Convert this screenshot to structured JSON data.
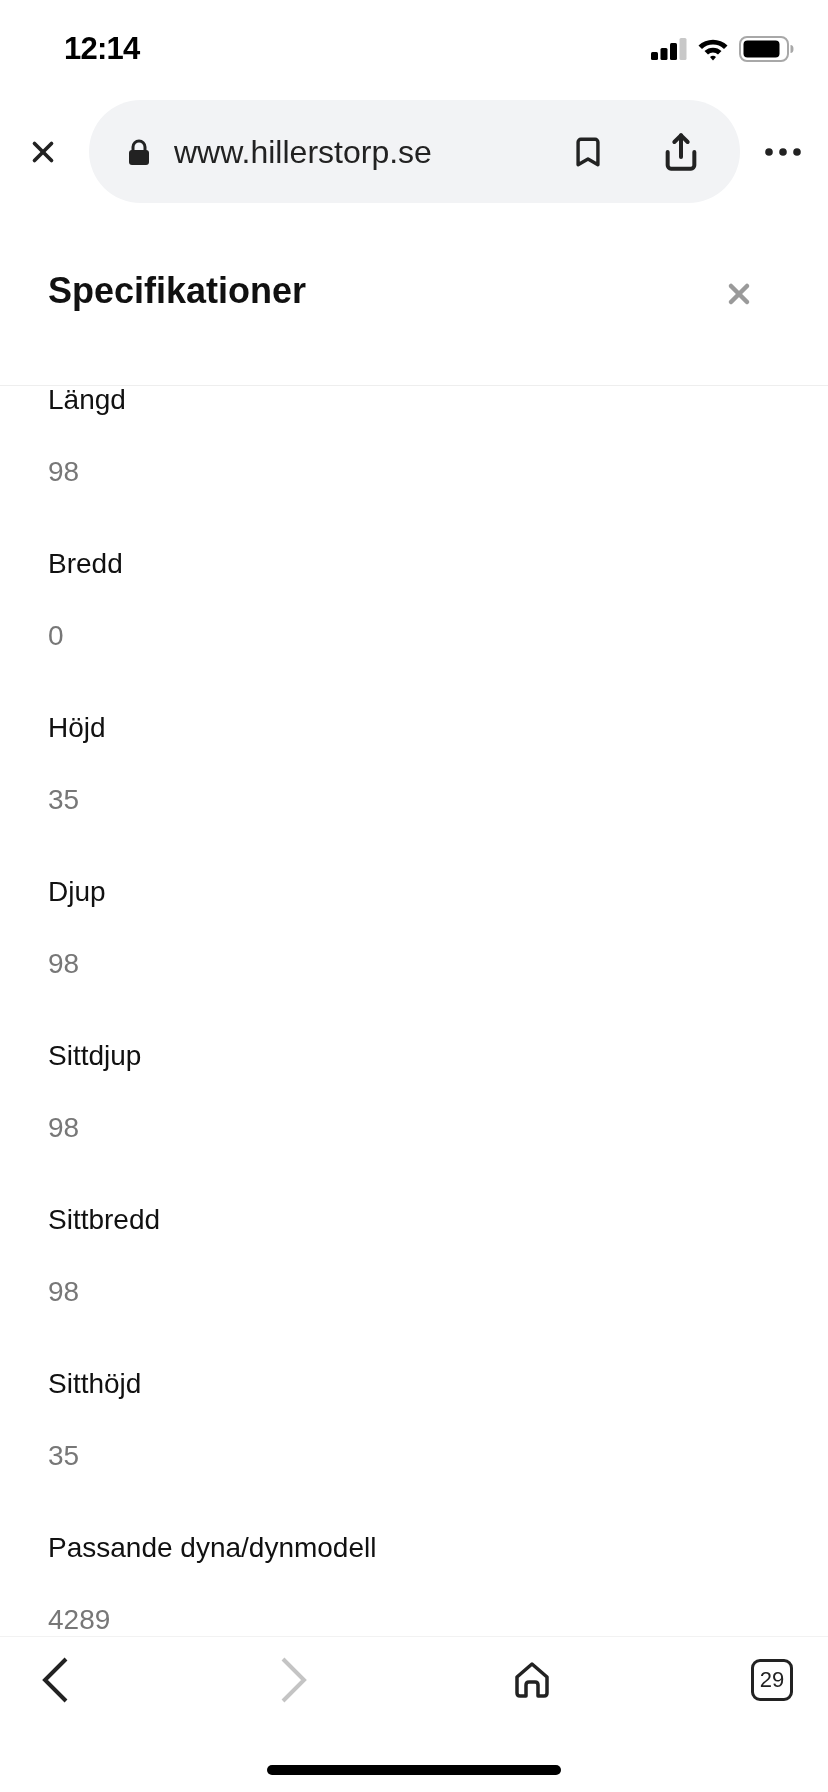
{
  "status_bar": {
    "time": "12:14"
  },
  "browser_bar": {
    "url": "www.hillerstorp.se"
  },
  "panel": {
    "title": "Specifikationer",
    "specs": [
      {
        "label": "Längd",
        "value": "98"
      },
      {
        "label": "Bredd",
        "value": "0"
      },
      {
        "label": "Höjd",
        "value": "35"
      },
      {
        "label": "Djup",
        "value": "98"
      },
      {
        "label": "Sittdjup",
        "value": "98"
      },
      {
        "label": "Sittbredd",
        "value": "98"
      },
      {
        "label": "Sitthöjd",
        "value": "35"
      },
      {
        "label": "Passande dyna/dynmodell",
        "value": "4289"
      }
    ]
  },
  "toolbar": {
    "buttons": [
      {
        "kind": "back",
        "disabled": false
      },
      {
        "kind": "forward",
        "disabled": true
      },
      {
        "kind": "home",
        "disabled": false
      },
      {
        "kind": "tabs",
        "disabled": false,
        "count": "29"
      }
    ]
  }
}
